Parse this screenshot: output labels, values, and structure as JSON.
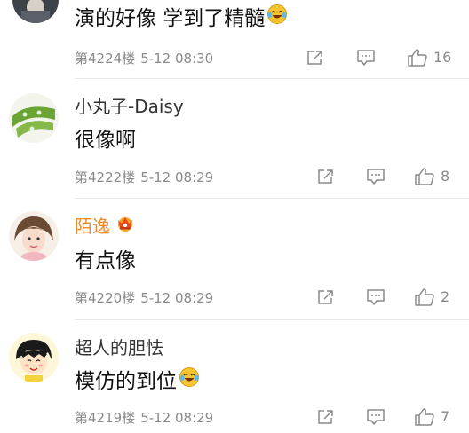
{
  "comments": [
    {
      "username": "",
      "text": "演的好像   学到了精髓",
      "emoji": "laughing-tears",
      "floor": "第4224楼",
      "time": "5-12 08:30",
      "likes": "16"
    },
    {
      "username": "小丸子-Daisy",
      "text": "很像啊",
      "emoji": "",
      "floor": "第4222楼",
      "time": "5-12 08:29",
      "likes": "8"
    },
    {
      "username": "陌逸",
      "vip": true,
      "text": "有点像",
      "emoji": "",
      "floor": "第4220楼",
      "time": "5-12 08:29",
      "likes": "2"
    },
    {
      "username": "超人的胆怯",
      "text": "模仿的到位",
      "emoji": "laughing-tears",
      "floor": "第4219楼",
      "time": "5-12 08:29",
      "likes": "7"
    }
  ],
  "colors": {
    "vip_name": "#f08a2e",
    "meta": "#8a8a8a",
    "divider": "#e6e6e6"
  }
}
